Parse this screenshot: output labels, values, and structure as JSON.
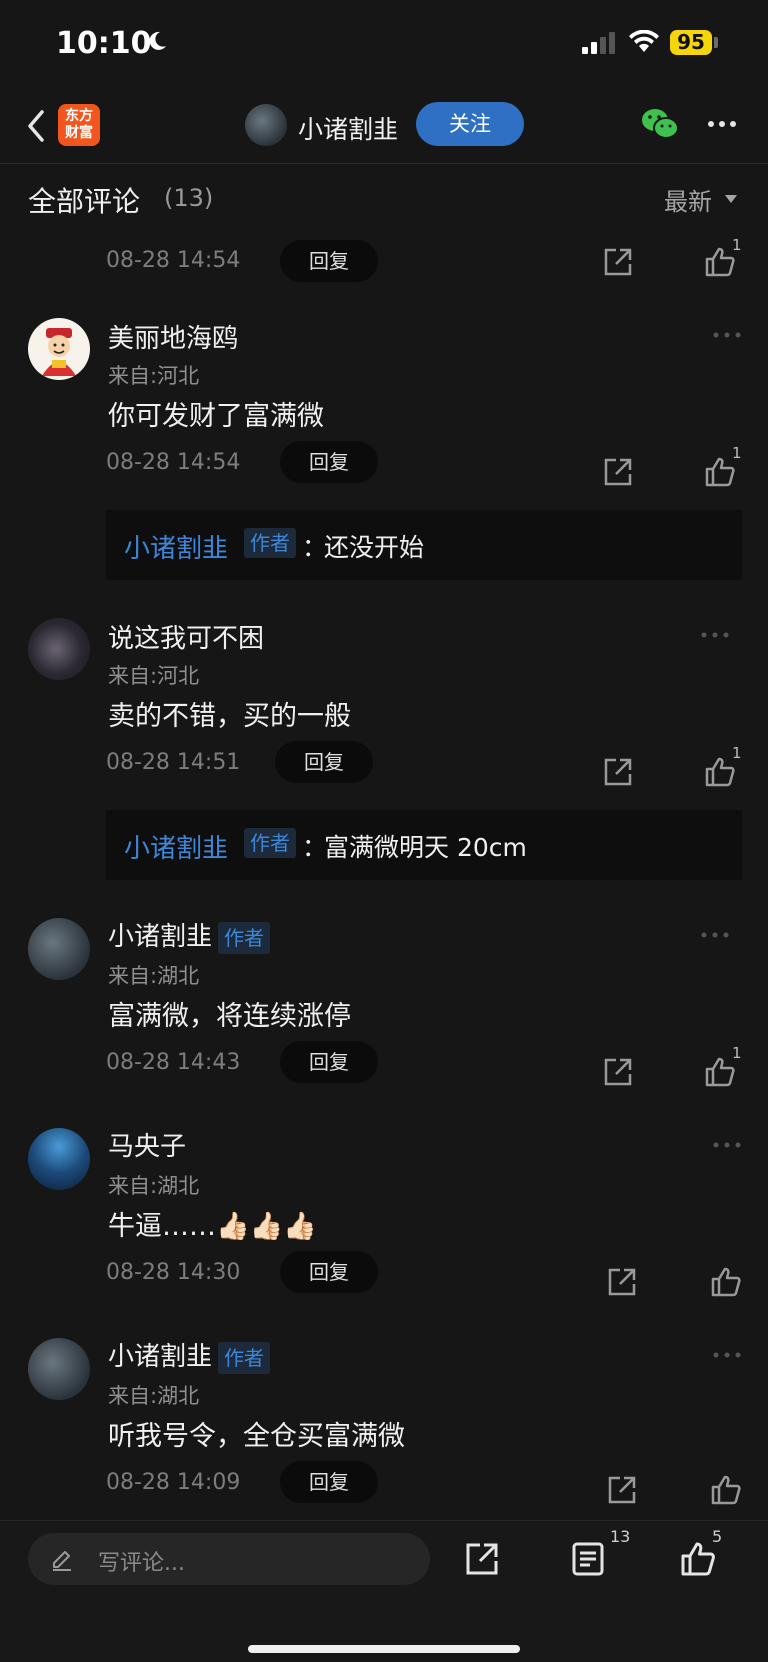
{
  "status_bar": {
    "time": "10:10",
    "battery": "95"
  },
  "navbar": {
    "logo_line1": "东方",
    "logo_line2": "财富",
    "author_name": "小诸割韭",
    "follow_label": "关注"
  },
  "comments_header": {
    "title": "全部评论",
    "count": "(13)",
    "sort_label": "最新"
  },
  "top_partial": {
    "date": "08-28 14:54",
    "reply_label": "回复",
    "likes": "1"
  },
  "comments": [
    {
      "name": "美丽地海鸥",
      "author_tag": "",
      "from": "来自:河北",
      "text": "你可发财了富满微",
      "date": "08-28 14:54",
      "reply_label": "回复",
      "likes": "1",
      "reply": {
        "author": "小诸割韭",
        "tag": "作者",
        "sep": "：",
        "text": "还没开始"
      }
    },
    {
      "name": "说这我可不困",
      "author_tag": "",
      "from": "来自:河北",
      "text": "卖的不错，买的一般",
      "date": "08-28 14:51",
      "reply_label": "回复",
      "likes": "1",
      "reply": {
        "author": "小诸割韭",
        "tag": "作者",
        "sep": "：",
        "text": "富满微明天 20cm"
      }
    },
    {
      "name": "小诸割韭",
      "author_tag": "作者",
      "from": "来自:湖北",
      "text": "富满微，将连续涨停",
      "date": "08-28 14:43",
      "reply_label": "回复",
      "likes": "1"
    },
    {
      "name": "马央子",
      "author_tag": "",
      "from": "来自:湖北",
      "text": "牛逼……👍🏻👍🏻👍🏻",
      "date": "08-28 14:30",
      "reply_label": "回复",
      "likes": ""
    },
    {
      "name": "小诸割韭",
      "author_tag": "作者",
      "from": "来自:湖北",
      "text": "听我号令，全仓买富满微",
      "date": "08-28 14:09",
      "reply_label": "回复",
      "likes": ""
    }
  ],
  "bottom_bar": {
    "write_placeholder": "写评论...",
    "comment_count": "13",
    "like_count": "5"
  },
  "colors": {
    "accent": "#2f6fc4",
    "author_blue": "#3e86d8",
    "background": "#161616",
    "logo": "#f0561d",
    "battery": "#f6d50b"
  }
}
